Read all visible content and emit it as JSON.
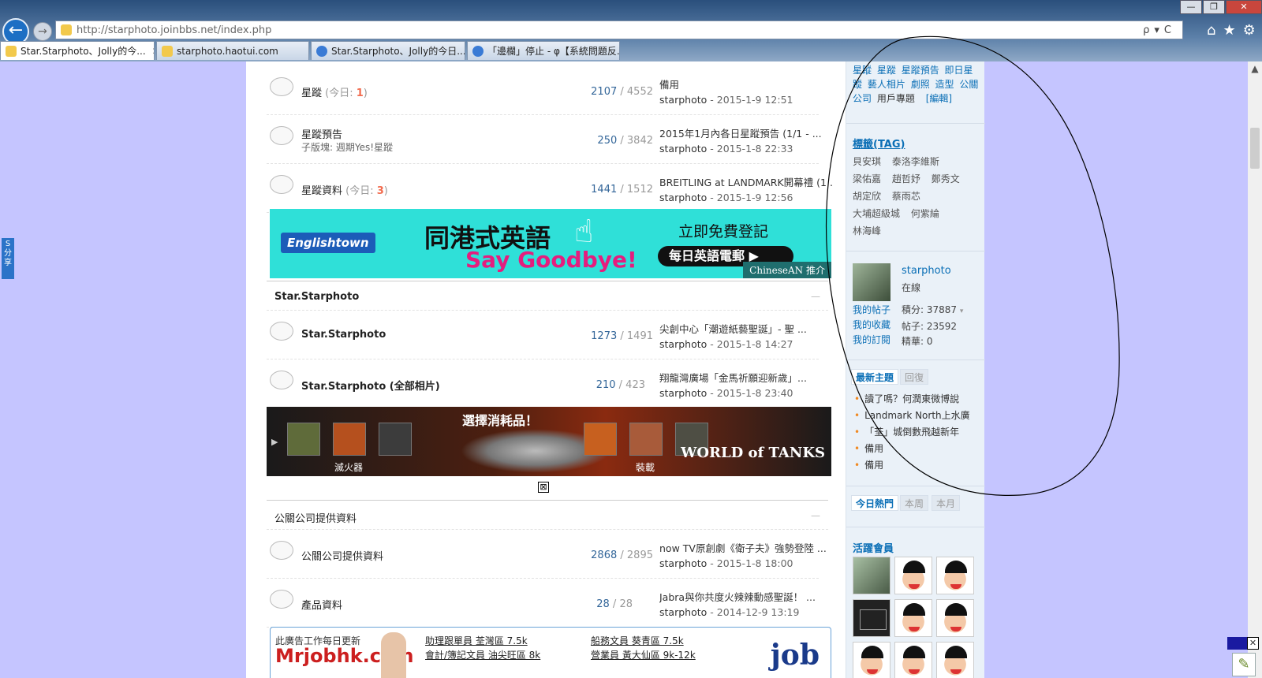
{
  "browser": {
    "address": "http://starphoto.joinbbs.net/index.php",
    "address_controls": "ρ▾C",
    "window_buttons": {
      "minimize": "—",
      "maximize": "❐",
      "close": "✕"
    },
    "tabs": [
      {
        "label": "Star.Starphoto、Jolly的今...",
        "active": true,
        "icon_color": "#f2c94c"
      },
      {
        "label": "starphoto.haotui.com",
        "active": false,
        "icon_color": "#f2c94c"
      },
      {
        "label": "Star.Starphoto、Jolly的今日...",
        "active": false,
        "icon_color": "#3a7bd5"
      },
      {
        "label": "「邊欄」停止 - φ【系統問題反...",
        "active": false,
        "icon_color": "#3a7bd5"
      }
    ],
    "tab_close": "✕"
  },
  "share_label": "S分享",
  "forums": [
    {
      "name": "星蹤",
      "today_label": "(今日: ",
      "today_count": "1",
      "today_end": ")",
      "sub": "",
      "topics": "2107",
      "posts": "4552",
      "last_title": "備用",
      "last_author": "starphoto",
      "last_time": "2015-1-9 12:51",
      "bold": false
    },
    {
      "name": "星蹤預告",
      "today_label": "",
      "today_count": "",
      "today_end": "",
      "sub": "子版塊: 週期Yes!星蹤",
      "topics": "250",
      "posts": "3842",
      "last_title": "2015年1月內各日星蹤預告 (1/1 - ...",
      "last_author": "starphoto",
      "last_time": "2015-1-8 22:33",
      "bold": false
    },
    {
      "name": "星蹤資料",
      "today_label": "(今日: ",
      "today_count": "3",
      "today_end": ")",
      "sub": "",
      "topics": "1441",
      "posts": "1512",
      "last_title": "BREITLING at LANDMARK開幕禮 (1 ...",
      "last_author": "starphoto",
      "last_time": "2015-1-9 12:56",
      "bold": false
    }
  ],
  "ad_englishtown": {
    "logo": "Englishtown",
    "headline": "同港式英語",
    "goodbye": "Say Goodbye!",
    "register": "立即免費登記",
    "email": "每日英語電郵 ▶",
    "brand": "ChineseAN 推介"
  },
  "section1": {
    "title": "Star.Starphoto",
    "collapse": "—"
  },
  "forums2": [
    {
      "name": "Star.Starphoto",
      "extra": "",
      "topics": "1273",
      "posts": "1491",
      "last_title": "尖創中心「潮遊紙藝聖誕」- 聖 ...",
      "last_author": "starphoto",
      "last_time": "2015-1-8 14:27"
    },
    {
      "name": "Star.Starphoto",
      "extra": " (全部相片)",
      "topics": "210",
      "posts": "423",
      "last_title": "翔龍灣廣場「金馬祈願迎新歲」...",
      "last_author": "starphoto",
      "last_time": "2015-1-8 23:40"
    }
  ],
  "ad_wot": {
    "headline": "選擇消耗品！",
    "cap1": "滅火器",
    "cap2": "裝載",
    "brand": "WORLD of TANKS"
  },
  "ad_close": "⊠",
  "section2": {
    "title": "公關公司提供資料",
    "collapse": "—"
  },
  "forums3": [
    {
      "name": "公關公司提供資料",
      "topics": "2868",
      "posts": "2895",
      "last_title": "now TV原創劇《衛子夫》強勢登陸 ...",
      "last_author": "starphoto",
      "last_time": "2015-1-8 18:00"
    },
    {
      "name": "產品資料",
      "topics": "28",
      "posts": "28",
      "last_title": "Jabra與你共度火辣辣動感聖誕！ ...",
      "last_author": "starphoto",
      "last_time": "2014-12-9 13:19"
    }
  ],
  "ad_jobs": {
    "note": "此廣告工作每日更新",
    "brand": "Mrjobhk.com",
    "col1": [
      "助理跟單員 荃灣區 7.5k",
      "會計/簿記文員 油尖旺區 8k"
    ],
    "col2": [
      "船務文員 葵青區 7.5k",
      "營業員 黃大仙區 9k-12k"
    ],
    "logo": "job"
  },
  "sidebar": {
    "top_tags": [
      "星蹤",
      "星蹤",
      "星蹤預告",
      "即日星蹤",
      "藝人相片",
      "劇照",
      "造型",
      "公關公司"
    ],
    "user_topics_label": "用戶專題",
    "edit": "[編輯]",
    "tag_heading": "標籤(TAG)",
    "tags": [
      "貝安琪",
      "泰洛李維斯",
      "梁佑嘉",
      "趙哲妤",
      "鄭秀文",
      "胡定欣",
      "蔡雨芯",
      "大埔超級城",
      "何紫綸",
      "林海峰"
    ],
    "user": {
      "name": "starphoto",
      "status": "在線",
      "links": [
        "我的帖子",
        "我的收藏",
        "我的訂閱"
      ],
      "credits": "積分: 37887",
      "posts": "帖子: 23592",
      "digest": "精華: 0"
    },
    "tabs1": [
      "最新主題",
      "回復"
    ],
    "threads": [
      "讀了嗎？何潤東微博說",
      "Landmark North上水廣",
      "「荃」城倒數飛越新年",
      "備用",
      "備用"
    ],
    "tabs2": [
      "今日熱門",
      "本周",
      "本月"
    ],
    "active_heading": "活躍會員"
  },
  "scroll_up": "▲",
  "corner": {
    "close": "✕",
    "icon": "✎"
  },
  "colors": {
    "accent": "#0b6fb6",
    "today_count": "#f26c4f",
    "page_bg": "#c5c5ff",
    "annotation": "#000000"
  }
}
